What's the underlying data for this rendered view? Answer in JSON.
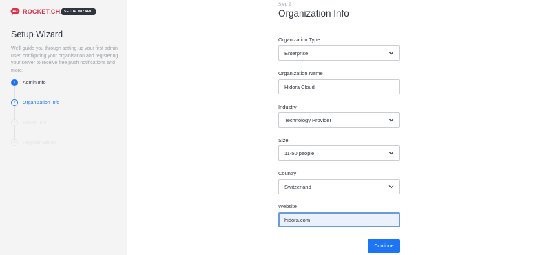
{
  "sidebar": {
    "logo_text": "ROCKET.CHAT",
    "badge": "SETUP WIZARD",
    "title": "Setup Wizard",
    "description": "We'll guide you through setting up your first admin user, configuring your organisation and registering your server to receive free push notifications and more.",
    "steps": [
      {
        "number": "1",
        "label": "Admin Info",
        "state": "done"
      },
      {
        "number": "2",
        "label": "Organization Info",
        "state": "active"
      },
      {
        "number": "3",
        "label": "Server Info",
        "state": "pending"
      },
      {
        "number": "4",
        "label": "Register Server",
        "state": "pending"
      }
    ]
  },
  "main": {
    "step_label": "Step 2",
    "title": "Organization Info",
    "fields": {
      "org_type": {
        "label": "Organization Type",
        "value": "Enterprise"
      },
      "org_name": {
        "label": "Organization Name",
        "value": "Hidora Cloud"
      },
      "industry": {
        "label": "Industry",
        "value": "Technology Provider"
      },
      "size": {
        "label": "Size",
        "value": "11-50 people"
      },
      "country": {
        "label": "Country",
        "value": "Switzerland"
      },
      "website": {
        "label": "Website",
        "value": "hidora.com"
      }
    },
    "continue_label": "Continue"
  },
  "colors": {
    "brand": "#d9324a",
    "accent": "#1d74f5",
    "sidebar_bg": "#f4f4f4"
  }
}
